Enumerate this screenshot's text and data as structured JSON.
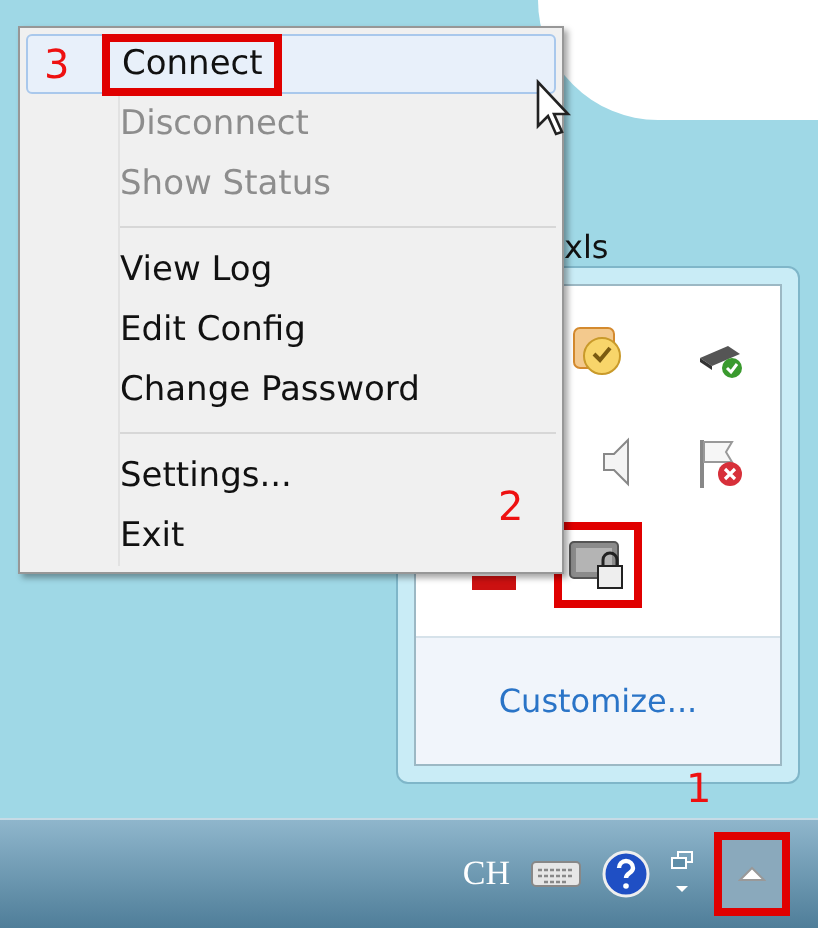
{
  "desktop": {
    "icon_label": "xls"
  },
  "menu": {
    "groups": [
      [
        {
          "label": "Connect",
          "disabled": false,
          "selected": true,
          "step": "3"
        },
        {
          "label": "Disconnect",
          "disabled": true,
          "selected": false
        },
        {
          "label": "Show Status",
          "disabled": true,
          "selected": false
        }
      ],
      [
        {
          "label": "View Log",
          "disabled": false,
          "selected": false
        },
        {
          "label": "Edit Config",
          "disabled": false,
          "selected": false
        },
        {
          "label": "Change Password",
          "disabled": false,
          "selected": false
        }
      ],
      [
        {
          "label": "Settings...",
          "disabled": false,
          "selected": false
        },
        {
          "label": "Exit",
          "disabled": false,
          "selected": false
        }
      ]
    ]
  },
  "tray_popup": {
    "step": "2",
    "link": "Customize..."
  },
  "taskbar": {
    "language": "CH",
    "step": "1"
  }
}
